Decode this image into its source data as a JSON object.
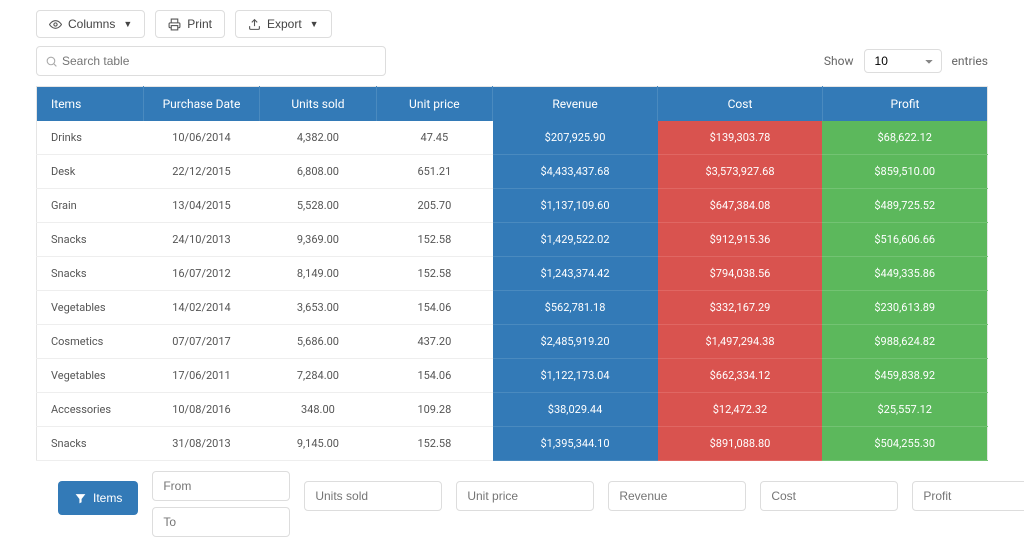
{
  "toolbar": {
    "columns_label": "Columns",
    "print_label": "Print",
    "export_label": "Export"
  },
  "search": {
    "placeholder": "Search table"
  },
  "pagination": {
    "show_label": "Show",
    "entries_label": "entries",
    "page_size": "10"
  },
  "columns": [
    "Items",
    "Purchase Date",
    "Units sold",
    "Unit price",
    "Revenue",
    "Cost",
    "Profit"
  ],
  "rows": [
    {
      "item": "Drinks",
      "date": "10/06/2014",
      "units": "4,382.00",
      "price": "47.45",
      "revenue": "$207,925.90",
      "cost": "$139,303.78",
      "profit": "$68,622.12"
    },
    {
      "item": "Desk",
      "date": "22/12/2015",
      "units": "6,808.00",
      "price": "651.21",
      "revenue": "$4,433,437.68",
      "cost": "$3,573,927.68",
      "profit": "$859,510.00"
    },
    {
      "item": "Grain",
      "date": "13/04/2015",
      "units": "5,528.00",
      "price": "205.70",
      "revenue": "$1,137,109.60",
      "cost": "$647,384.08",
      "profit": "$489,725.52"
    },
    {
      "item": "Snacks",
      "date": "24/10/2013",
      "units": "9,369.00",
      "price": "152.58",
      "revenue": "$1,429,522.02",
      "cost": "$912,915.36",
      "profit": "$516,606.66"
    },
    {
      "item": "Snacks",
      "date": "16/07/2012",
      "units": "8,149.00",
      "price": "152.58",
      "revenue": "$1,243,374.42",
      "cost": "$794,038.56",
      "profit": "$449,335.86"
    },
    {
      "item": "Vegetables",
      "date": "14/02/2014",
      "units": "3,653.00",
      "price": "154.06",
      "revenue": "$562,781.18",
      "cost": "$332,167.29",
      "profit": "$230,613.89"
    },
    {
      "item": "Cosmetics",
      "date": "07/07/2017",
      "units": "5,686.00",
      "price": "437.20",
      "revenue": "$2,485,919.20",
      "cost": "$1,497,294.38",
      "profit": "$988,624.82"
    },
    {
      "item": "Vegetables",
      "date": "17/06/2011",
      "units": "7,284.00",
      "price": "154.06",
      "revenue": "$1,122,173.04",
      "cost": "$662,334.12",
      "profit": "$459,838.92"
    },
    {
      "item": "Accessories",
      "date": "10/08/2016",
      "units": "348.00",
      "price": "109.28",
      "revenue": "$38,029.44",
      "cost": "$12,472.32",
      "profit": "$25,557.12"
    },
    {
      "item": "Snacks",
      "date": "31/08/2013",
      "units": "9,145.00",
      "price": "152.58",
      "revenue": "$1,395,344.10",
      "cost": "$891,088.80",
      "profit": "$504,255.30"
    }
  ],
  "filters": {
    "button_label": "Items",
    "from_placeholder": "From",
    "to_placeholder": "To",
    "units_placeholder": "Units sold",
    "price_placeholder": "Unit price",
    "revenue_placeholder": "Revenue",
    "cost_placeholder": "Cost",
    "profit_placeholder": "Profit"
  }
}
